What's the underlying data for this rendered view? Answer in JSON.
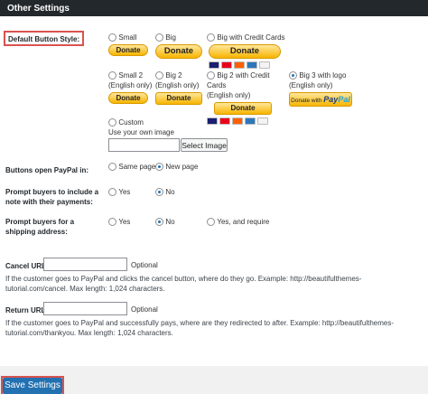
{
  "header": {
    "title": "Other Settings"
  },
  "button_style": {
    "label": "Default Button Style:",
    "options": [
      {
        "text": "Small",
        "button": "Donate",
        "checked": false
      },
      {
        "text": "Big",
        "button": "Donate",
        "checked": false
      },
      {
        "text": "Big with Credit Cards",
        "button": "Donate",
        "checked": false
      },
      {
        "text": "Small 2\n(English only)",
        "button": "Donate",
        "checked": false
      },
      {
        "text": "Big 2\n(English only)",
        "button": "Donate",
        "checked": false
      },
      {
        "text": "Big 2 with Credit Cards\n(English only)",
        "button": "Donate",
        "checked": false
      },
      {
        "text": "Big 3 with logo\n(English only)",
        "button": "Donate with",
        "logo_a": "Pay",
        "logo_b": "Pal",
        "checked": true
      }
    ],
    "custom": {
      "text": "Custom",
      "sub": "Use your own image",
      "select_label": "Select Image"
    },
    "card_colors": [
      "#1a1f71",
      "#eb001b",
      "#ff5f00",
      "#2e77bb",
      "#f3f3f3"
    ]
  },
  "open_paypal": {
    "label": "Buttons open PayPal in:",
    "options": [
      {
        "text": "Same page",
        "checked": false
      },
      {
        "text": "New page",
        "checked": true
      }
    ]
  },
  "note": {
    "label": "Prompt buyers to include a note with their payments:",
    "options": [
      {
        "text": "Yes",
        "checked": false
      },
      {
        "text": "No",
        "checked": true
      }
    ]
  },
  "shipping": {
    "label": "Prompt buyers for a shipping address:",
    "options": [
      {
        "text": "Yes",
        "checked": false
      },
      {
        "text": "No",
        "checked": true
      },
      {
        "text": "Yes, and require",
        "checked": false
      }
    ]
  },
  "cancel": {
    "label": "Cancel URL:",
    "value": "",
    "optional": "Optional",
    "help": "If the customer goes to PayPal and clicks the cancel button, where do they go. Example: http://beautifulthemes-tutorial.com/cancel. Max length: 1,024 characters."
  },
  "return": {
    "label": "Return URL:",
    "value": "",
    "optional": "Optional",
    "help": "If the customer goes to PayPal and successfully pays, where are they redirected to after. Example: http://beautifulthemes-tutorial.com/thankyou. Max length: 1,024 characters."
  },
  "footer": {
    "save_label": "Save Settings"
  }
}
